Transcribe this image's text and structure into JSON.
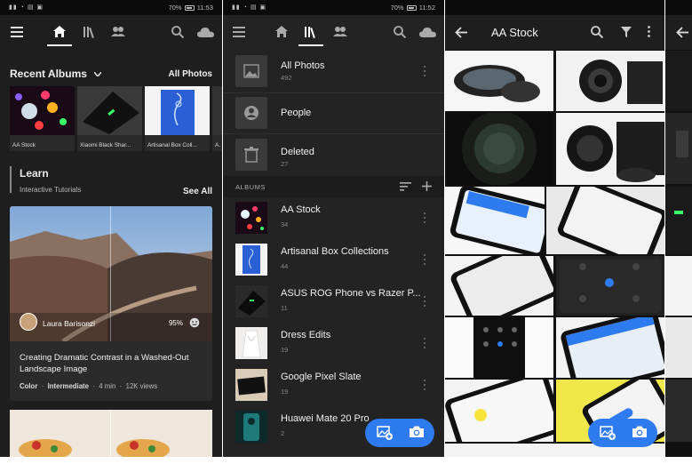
{
  "status_left": {
    "carrier_icons": "signal-wifi-nfc",
    "battery": "70%",
    "time": "11:53"
  },
  "status_mid": {
    "battery": "70%",
    "time": "11:52"
  },
  "home": {
    "recent_albums_label": "Recent Albums",
    "all_photos_link": "All Photos",
    "recent_albums": [
      {
        "name": "AA Stock"
      },
      {
        "name": "Xiaomi Black Shar..."
      },
      {
        "name": "Artisanal Box Coll..."
      },
      {
        "name": "AS"
      }
    ],
    "learn_title": "Learn",
    "learn_subtitle": "Interactive Tutorials",
    "see_all": "See All",
    "tutorial": {
      "author": "Laura Barisonzi",
      "progress": "95%",
      "title": "Creating Dramatic Contrast in a Washed-Out Landscape Image",
      "level_tag": "Color",
      "difficulty": "Intermediate",
      "duration": "4 min",
      "views": "12K views"
    }
  },
  "library": {
    "top_items": [
      {
        "name": "All Photos",
        "count": "492",
        "icon": "photo-icon"
      },
      {
        "name": "People",
        "count": "",
        "icon": "person-icon"
      },
      {
        "name": "Deleted",
        "count": "27",
        "icon": "trash-icon"
      }
    ],
    "albums_header": "ALBUMS",
    "albums": [
      {
        "name": "AA Stock",
        "count": "34"
      },
      {
        "name": "Artisanal Box Collections",
        "count": "44"
      },
      {
        "name": "ASUS ROG Phone vs Razer P...",
        "count": "11"
      },
      {
        "name": "Dress Edits",
        "count": "19"
      },
      {
        "name": "Google Pixel Slate",
        "count": "19"
      },
      {
        "name": "Huawei Mate 20 Pro",
        "count": "2"
      }
    ]
  },
  "album_view": {
    "title": "AA Stock"
  },
  "colors": {
    "accent": "#2e7bf0",
    "background": "#1e1e1e"
  }
}
